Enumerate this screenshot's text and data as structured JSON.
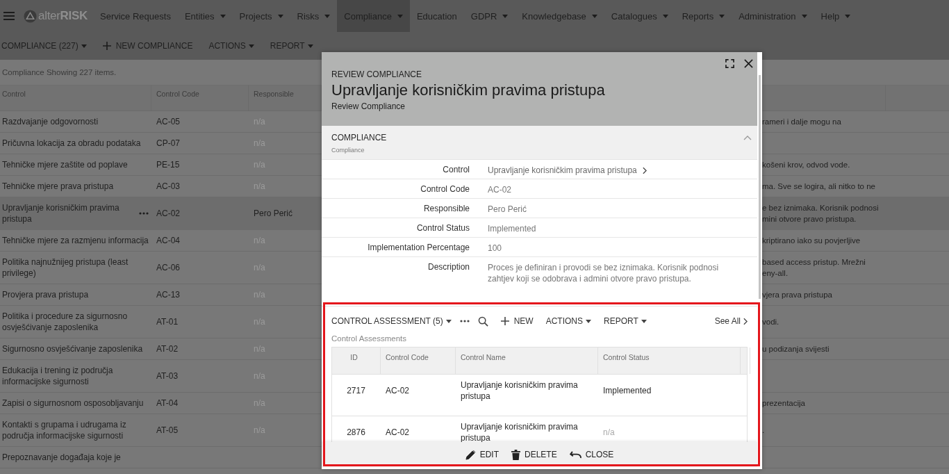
{
  "nav": {
    "logo": "alter**RISK**",
    "items": [
      {
        "label": "Service Requests",
        "dropdown": false,
        "selected": false
      },
      {
        "label": "Entities",
        "dropdown": true,
        "selected": false
      },
      {
        "label": "Projects",
        "dropdown": true,
        "selected": false
      },
      {
        "label": "Risks",
        "dropdown": true,
        "selected": false
      },
      {
        "label": "Compliance",
        "dropdown": true,
        "selected": true
      },
      {
        "label": "Education",
        "dropdown": false,
        "selected": false
      },
      {
        "label": "GDPR",
        "dropdown": true,
        "selected": false
      },
      {
        "label": "Knowledgebase",
        "dropdown": true,
        "selected": false
      },
      {
        "label": "Catalogues",
        "dropdown": true,
        "selected": false
      },
      {
        "label": "Reports",
        "dropdown": true,
        "selected": false
      },
      {
        "label": "Administration",
        "dropdown": true,
        "selected": false
      },
      {
        "label": "Help",
        "dropdown": true,
        "selected": false
      }
    ]
  },
  "toolbar": [
    {
      "label": "COMPLIANCE (227)",
      "kind": "dropdown"
    },
    {
      "label": "NEW COMPLIANCE",
      "kind": "add"
    },
    {
      "label": "ACTIONS",
      "kind": "dropdown"
    },
    {
      "label": "REPORT",
      "kind": "dropdown"
    }
  ],
  "list": {
    "summary": "Compliance Showing 227 items.",
    "columns": [
      "Control",
      "Control Code",
      "Responsible"
    ],
    "rows": [
      {
        "control": "Razdvajanje odgovornosti",
        "code": "AC-05",
        "responsible": "n/a",
        "muted": true,
        "description": "rameri i dalje mogu na",
        "selected": false
      },
      {
        "control": "Pričuvna lokacija za obradu podataka",
        "code": "CP-07",
        "responsible": "n/a",
        "muted": true,
        "selected": false
      },
      {
        "control": "Tehničke mjere zaštite od poplave",
        "code": "PE-15",
        "responsible": "n/a",
        "muted": true,
        "description": "košeni krov, odvod vode.",
        "selected": false
      },
      {
        "control": "Tehničke mjere prava pristupa",
        "code": "AC-03",
        "responsible": "n/a",
        "muted": true,
        "description": "ma. Sve se logira, ali nitko to ne",
        "selected": false
      },
      {
        "control": "Upravljanje korisničkim pravima pristupa",
        "code": "AC-02",
        "responsible": "Pero Perić",
        "muted": false,
        "description": "e bez iznimaka. Korisnik podnosi\nmini otvore pravo pristupa.",
        "selected": true
      },
      {
        "control": "Tehničke mjere za razmjenu informacija",
        "code": "AC-04",
        "responsible": "n/a",
        "muted": true,
        "description": "kriptirano iako su povjerljive",
        "selected": false
      },
      {
        "control": "Politika najnužnijeg pristupa (least privilege)",
        "code": "AC-06",
        "responsible": "n/a",
        "muted": true,
        "description": "based access pristup. Mrežni\neny-all.",
        "selected": false
      },
      {
        "control": "Provjera prava pristupa",
        "code": "AC-13",
        "responsible": "n/a",
        "muted": true,
        "description": "vjera prava pristupa",
        "selected": false
      },
      {
        "control": "Politika i procedure za sigurnosno osvješćivanje zaposlenika",
        "code": "AT-01",
        "responsible": "n/a",
        "muted": true,
        "description": "vodi.",
        "selected": false
      },
      {
        "control": "Sigurnosno osvješćivanje zaposlenika",
        "code": "AT-02",
        "responsible": "n/a",
        "muted": true,
        "description": "u podizanja svijesti",
        "selected": false
      },
      {
        "control": "Edukacija i trening iz područja informacijske sigurnosti",
        "code": "AT-03",
        "responsible": "n/a",
        "muted": true,
        "selected": false
      },
      {
        "control": "Zapisi o sigurnosnom osposobljavanju",
        "code": "AT-04",
        "responsible": "n/a",
        "muted": true,
        "description": "prezentacija",
        "selected": false
      },
      {
        "control": "Kontakti s grupama i udrugama iz područja informacijske sigurnosti",
        "code": "AT-05",
        "responsible": "n/a",
        "muted": true,
        "description": ".",
        "selected": false
      },
      {
        "control": "Prepoznavanje događaja koje je",
        "selected": false
      }
    ]
  },
  "modal": {
    "eyebrow": "REVIEW COMPLIANCE",
    "title": "Upravljanje korisničkim pravima pristupa",
    "subtitle": "Review Compliance",
    "section": {
      "title": "COMPLIANCE",
      "caption": "Compliance",
      "expanded": true,
      "fields": [
        {
          "label": "Control",
          "value": "Upravljanje korisničkim pravima pristupa",
          "kind": "link"
        },
        {
          "label": "Control Code",
          "value": "AC-02",
          "kind": "text"
        },
        {
          "label": "Responsible",
          "value": "Pero Perić",
          "kind": "text"
        },
        {
          "label": "Control Status",
          "value": "Implemented",
          "kind": "text"
        },
        {
          "label": "Implementation Percentage",
          "value": "100",
          "kind": "text"
        },
        {
          "label": "Description",
          "value": "Proces je definiran i provodi se bez iznimaka. Korisnik podnosi\nzahtjev koji se odobrava i admini otvore pravo pristupa.",
          "kind": "text"
        }
      ]
    },
    "subgrid": {
      "title": "CONTROL ASSESSMENT (5)",
      "actions": [
        {
          "label": "NEW",
          "kind": "add"
        },
        {
          "label": "ACTIONS",
          "kind": "dropdown"
        },
        {
          "label": "REPORT",
          "kind": "dropdown"
        }
      ],
      "see_all": "See All",
      "caption": "Control Assessments",
      "columns": [
        "ID",
        "Control Code",
        "Control Name",
        "Control Status"
      ],
      "rows": [
        {
          "id": "2717",
          "code": "AC-02",
          "name": "Upravljanje korisničkim pravima pristupa",
          "status": "Implemented",
          "muted": false
        },
        {
          "id": "2876",
          "code": "AC-02",
          "name": "Upravljanje korisničkim pravima pristupa",
          "status": "n/a",
          "muted": true
        }
      ]
    },
    "footer": [
      {
        "label": "EDIT",
        "kind": "edit"
      },
      {
        "label": "DELETE",
        "kind": "delete"
      },
      {
        "label": "CLOSE",
        "kind": "close"
      }
    ]
  }
}
